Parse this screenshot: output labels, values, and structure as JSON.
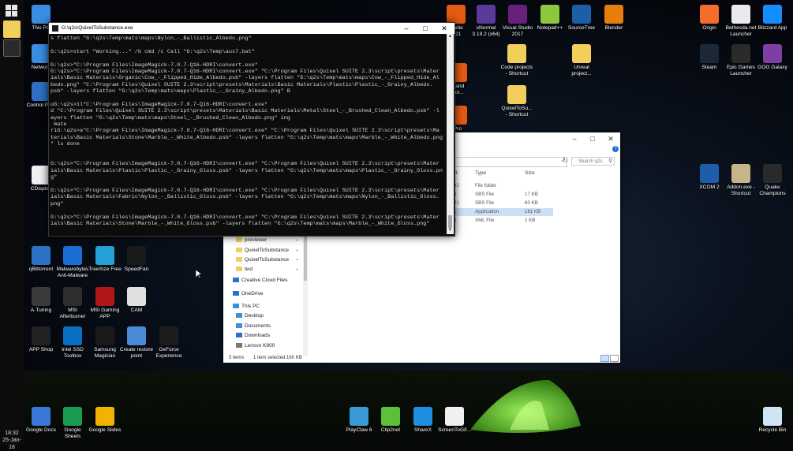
{
  "taskbar": {
    "time": "18:32",
    "date": "25-Jan-18"
  },
  "desktop_icons": [
    {
      "id": "this-pc",
      "label": "This PC",
      "color": "#3a8de0"
    },
    {
      "id": "network",
      "label": "Network",
      "color": "#3a8de0"
    },
    {
      "id": "control-panel",
      "label": "Control Pa...",
      "color": "#2f6fc4"
    },
    {
      "id": "cdisplay",
      "label": "CDisplay",
      "color": "#f0f0f0"
    },
    {
      "id": "qbittorrent",
      "label": "qBittorrent",
      "color": "#2c73c6"
    },
    {
      "id": "malwarebytes",
      "label": "Malwarebytes\nAnti-Malware",
      "color": "#1b6fd2"
    },
    {
      "id": "treesize",
      "label": "TreeSize Free",
      "color": "#27a0d8"
    },
    {
      "id": "speedfan",
      "label": "SpeedFan",
      "color": "#1a1a1a"
    },
    {
      "id": "a-tuning",
      "label": "A-Tuning",
      "color": "#3a3a3a"
    },
    {
      "id": "msi-afterburner",
      "label": "MSI\nAfterburner",
      "color": "#2e2e2e"
    },
    {
      "id": "msi-gaming-app",
      "label": "MSI Gaming\nAPP",
      "color": "#b01818"
    },
    {
      "id": "cam",
      "label": "CAM",
      "color": "#e0e0e0"
    },
    {
      "id": "app-shop",
      "label": "APP Shop",
      "color": "#222"
    },
    {
      "id": "intel-ssd-toolbox",
      "label": "Intel SSD\nToolbox",
      "color": "#0a6fc2"
    },
    {
      "id": "samsung-magician",
      "label": "Samsung\nMagician",
      "color": "#1a1a1a"
    },
    {
      "id": "create-restore-point",
      "label": "Create restore\npoint",
      "color": "#4a8ad8"
    },
    {
      "id": "geforce-experience",
      "label": "GeForce\nExperience",
      "color": "#1d1d1d"
    },
    {
      "id": "google-docs",
      "label": "Google Docs",
      "color": "#3c78d8"
    },
    {
      "id": "google-sheets",
      "label": "Google\nSheets",
      "color": "#1e9b53"
    },
    {
      "id": "google-slides",
      "label": "Google Slides",
      "color": "#f0b400"
    },
    {
      "id": "playclaw",
      "label": "PlayClaw 6",
      "color": "#3a9ad8"
    },
    {
      "id": "clip2net",
      "label": "Clip2net",
      "color": "#5cc03a"
    },
    {
      "id": "sharex",
      "label": "ShareX",
      "color": "#1e8ee0"
    },
    {
      "id": "screentogif",
      "label": "ScreenToGif...",
      "color": "#f0f0f0"
    },
    {
      "id": "recycle-bin",
      "label": "Recycle Bin",
      "color": "#cfe4f5"
    },
    {
      "id": "code-projects",
      "label": "Code projects\n- Shortcut",
      "color": "#f2cf5b"
    },
    {
      "id": "unreal-project",
      "label": "Unreal\nproject...",
      "color": "#f2cf5b"
    },
    {
      "id": "quixeltosub-shortcut",
      "label": "QuixelToSu...\n- Shortcut",
      "color": "#f2cf5b"
    },
    {
      "id": "xnormal",
      "label": "xNormal\n3.19.2 (x64)",
      "color": "#5a3a9a"
    },
    {
      "id": "visual-studio",
      "label": "Visual Studio\n2017",
      "color": "#68217a"
    },
    {
      "id": "notepadpp",
      "label": "Notepad++",
      "color": "#8dc63f"
    },
    {
      "id": "sourcetree",
      "label": "SourceTree",
      "color": "#1d5ea8"
    },
    {
      "id": "blender",
      "label": "Blender",
      "color": "#e87d0d"
    },
    {
      "id": "origin",
      "label": "Origin",
      "color": "#f56c2d"
    },
    {
      "id": "bethesda",
      "label": "Bethesda.net\nLauncher",
      "color": "#eaeaea"
    },
    {
      "id": "blizzard",
      "label": "Blizzard App",
      "color": "#148eff"
    },
    {
      "id": "steam",
      "label": "Steam",
      "color": "#1b2838"
    },
    {
      "id": "epic-games",
      "label": "Epic Games\nLauncher",
      "color": "#2a2a2a"
    },
    {
      "id": "gog-galaxy",
      "label": "GOG Galaxy",
      "color": "#7d3fa3"
    },
    {
      "id": "xcom2",
      "label": "XCOM 2",
      "color": "#1c5fa8"
    },
    {
      "id": "addon-exe",
      "label": "Addon.exe -\nShortcut",
      "color": "#c7b48a"
    },
    {
      "id": "quake-champions",
      "label": "Quake\nChampions",
      "color": "#2a2a2a"
    },
    {
      "id": "houdini-indie",
      "label": "i Indie\n.321",
      "color": "#e55b13"
    },
    {
      "id": "substance",
      "label": "mand\nSol...",
      "color": "#e55b13"
    },
    {
      "id": "substance-pro",
      "label": "Pro\nent...",
      "color": "#e55b13"
    }
  ],
  "console": {
    "title": "G:\\q2s\\QuixelToSubstance.exe",
    "lines": [
      "s flatten \"G:\\q2s\\Temp\\mats\\maps\\Nylon_-_Ballistic_Albedo.png\"",
      "",
      "G:\\q2s>start \"Working...\" /b cmd /c Call \"G:\\q2s\\Temp\\aux7.bat\"",
      "",
      "G:\\q2s>\"C:\\Program Files\\ImageMagick-7.0.7-Q16-HDRI\\convert.exe\"",
      "G:\\q2s>\"C:\\Program Files\\ImageMagick-7.0.7-Q16-HDRI\\convert.exe\" \"C:\\Program Files\\Quixel SUITE 2.3\\script\\presets\\Mater",
      "ials\\Basic Materials\\Organic\\Cow_-_Flipped_Hide_Albedo.psb\" -layers flatten \"G:\\q2s\\Temp\\mats\\maps\\Cow_-_Flipped_Hide_Al",
      "bedo.png\" \"C:\\Program Files\\Quixel SUITE 2.3\\script\\presets\\Materials\\Basic Materials\\Plastic\\Plastic_-_Grainy_Albedo.",
      "psb\" -layers flatten \"G:\\q2s\\Temp\\mats\\maps\\Plastic_-_Grainy_Albedo.png\" B",
      "",
      "uG:\\q2s>1l\"C:\\Program Files\\ImageMagick-7.0.7-Q16-HDRI\\convert.exe\"",
      "d \"C:\\Program Files\\Quixel SUITE 2.3\\script\\presets\\Materials\\Basic Materials\\Metal\\Steel_-_Brushed_Clean_Albedo.psb\" -l",
      "ayers flatten \"G:\\q2s\\Temp\\mats\\maps\\Steel_-_Brushed_Clean_Albedo.png\" ing",
      " mate",
      "riG:\\q2s>a\"C:\\Program Files\\ImageMagick-7.0.7-Q16-HDRI\\convert.exe\" \"C:\\Program Files\\Quixel SUITE 2.3\\script\\presets\\Ma",
      "terials\\Basic Materials\\Stone\\Marble_-_White_Albedo.psb\" -layers flatten \"G:\\q2s\\Temp\\mats\\maps\\Marble_-_White_Albedo.png",
      "\" ls done",
      "",
      "",
      "G:\\q2s>\"C:\\Program Files\\ImageMagick-7.0.7-Q16-HDRI\\convert.exe\" \"C:\\Program Files\\Quixel SUITE 2.3\\script\\presets\\Mater",
      "ials\\Basic Materials\\Plastic\\Plastic_-_Grainy_Gloss.psb\" -layers flatten \"G:\\q2s\\Temp\\mats\\maps\\Plastic_-_Grainy_Gloss.pn",
      "g\"",
      "",
      "G:\\q2s>\"C:\\Program Files\\ImageMagick-7.0.7-Q16-HDRI\\convert.exe\" \"C:\\Program Files\\Quixel SUITE 2.3\\script\\presets\\Mater",
      "ials\\Basic Materials\\Fabric\\Nylon_-_Ballistic_Gloss.psb\" -layers flatten \"G:\\q2s\\Temp\\mats\\maps\\Nylon_-_Ballistic_Gloss.",
      "png\"",
      "",
      "G:\\q2s>\"C:\\Program Files\\ImageMagick-7.0.7-Q16-HDRI\\convert.exe\" \"C:\\Program Files\\Quixel SUITE 2.3\\script\\presets\\Mater",
      "ials\\Basic Materials\\Stone\\Marble_-_White_Gloss.psb\" -layers flatten \"G:\\q2s\\Temp\\mats\\maps\\Marble_-_White_Gloss.png\"",
      "",
      "_"
    ]
  },
  "explorer": {
    "search_placeholder": "Search q2s",
    "columns": [
      "Type",
      "Size"
    ],
    "rows": [
      {
        "mod": "32",
        "type": "File folder",
        "size": ""
      },
      {
        "mod": "6",
        "type": "SBS File",
        "size": "17 KB"
      },
      {
        "mod": "21",
        "type": "SBS File",
        "size": "60 KB"
      },
      {
        "mod": "1",
        "type": "Application",
        "size": "161 KB",
        "selected": true
      },
      {
        "mod": "5",
        "type": "XML File",
        "size": "1 KB"
      }
    ],
    "nav": [
      {
        "label": "Houdini Tests .ST",
        "kind": "folder",
        "pinned": true
      },
      {
        "label": "previewer",
        "kind": "folder",
        "pinned": true
      },
      {
        "label": "QuixelToSubstance",
        "kind": "folder",
        "pinned": true
      },
      {
        "label": "QuixelToSubstance",
        "kind": "folder",
        "pinned": true
      },
      {
        "label": "test",
        "kind": "folder",
        "pinned": true
      },
      {
        "label": "Creative Cloud Files",
        "kind": "cloud"
      },
      {
        "label": "OneDrive",
        "kind": "cloud"
      },
      {
        "label": "This PC",
        "kind": "pc"
      },
      {
        "label": "Desktop",
        "kind": "folder-blue"
      },
      {
        "label": "Documents",
        "kind": "folder-blue"
      },
      {
        "label": "Downloads",
        "kind": "download"
      },
      {
        "label": "Lenovo K900",
        "kind": "device"
      }
    ],
    "status": {
      "items": "5 items",
      "selected": "1 item selected  160 KB"
    }
  }
}
